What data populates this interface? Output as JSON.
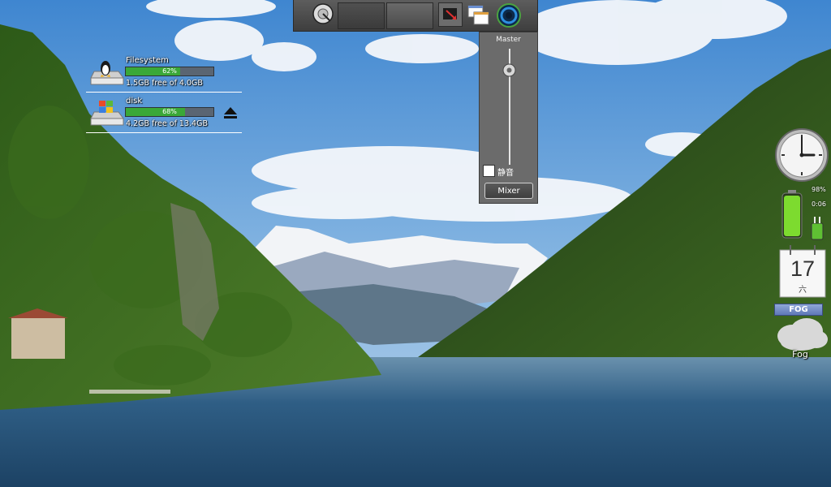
{
  "desktop": {
    "disks": [
      {
        "name": "Filesystem",
        "percent_label": "62%",
        "usage": 0.62,
        "info": "1.5GB free of 4.0GB"
      },
      {
        "name": "disk",
        "percent_label": "68%",
        "usage": 0.68,
        "info": "4.2GB free of 13.4GB"
      }
    ]
  },
  "volume": {
    "title": "Master",
    "mute_label": "静音",
    "mute_checked": false,
    "mixer_label": "Mixer",
    "level": 0.82
  },
  "battery": {
    "percent": "98%",
    "time": "0:06",
    "level": 0.98
  },
  "calendar": {
    "day": "17",
    "weekday": "六"
  },
  "clock": {
    "hour": 3,
    "minute": 0
  },
  "weather": {
    "tag": "FOG",
    "condition": "Fog"
  },
  "colors": {
    "disk_fill": "#3aa838",
    "battery": "#7ddb2f",
    "panel": "#4a4a4a"
  }
}
